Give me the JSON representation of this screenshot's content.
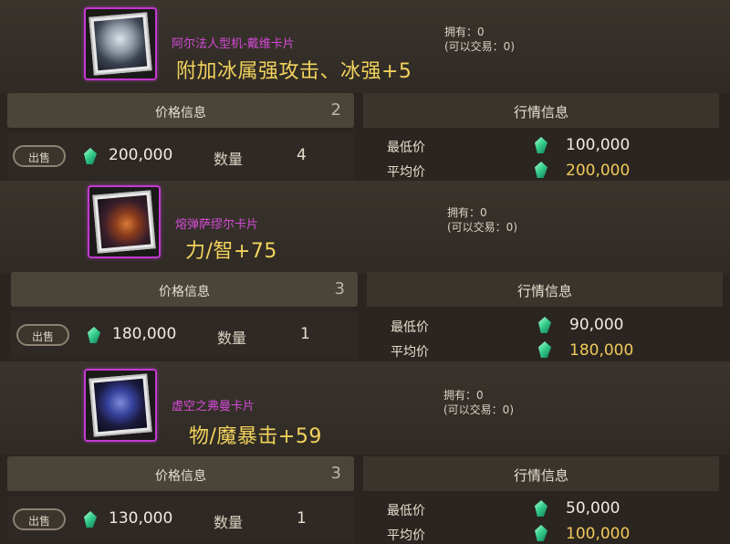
{
  "listings": [
    {
      "card_name": "阿尔法人型机-戴维卡片",
      "effect": "附加冰属强攻击、冰强+5",
      "owned": "拥有：0",
      "tradable": "(可以交易：0)",
      "price_header": "价格信息",
      "price_header_count": "2",
      "sell_label": "出售",
      "price": "200,000",
      "qty_label": "数量",
      "qty": "4",
      "market_header": "行情信息",
      "min_label": "最低价",
      "min_price": "100,000",
      "avg_label": "平均价",
      "avg_price": "200,000",
      "art": "silver-haired-android-portrait"
    },
    {
      "card_name": "熔弹萨缪尔卡片",
      "effect": "力/智+75",
      "owned": "拥有：0",
      "tradable": "(可以交易：0)",
      "price_header": "价格信息",
      "price_header_count": "3",
      "sell_label": "出售",
      "price": "180,000",
      "qty_label": "数量",
      "qty": "1",
      "market_header": "行情信息",
      "min_label": "最低价",
      "min_price": "90,000",
      "avg_label": "平均价",
      "avg_price": "180,000",
      "art": "molten-armor-portrait"
    },
    {
      "card_name": "虚空之弗曼卡片",
      "effect": "物/魔暴击+59",
      "owned": "拥有：0",
      "tradable": "(可以交易：0)",
      "price_header": "价格信息",
      "price_header_count": "3",
      "sell_label": "出售",
      "price": "130,000",
      "qty_label": "数量",
      "qty": "1",
      "market_header": "行情信息",
      "min_label": "最低价",
      "min_price": "50,000",
      "avg_label": "平均价",
      "avg_price": "100,000",
      "art": "void-creature-portrait"
    }
  ],
  "colors": {
    "card_name": "#d54bd8",
    "effect": "#f2d35d",
    "avg_price": "#f2c95a",
    "gem": "#39d18f"
  }
}
